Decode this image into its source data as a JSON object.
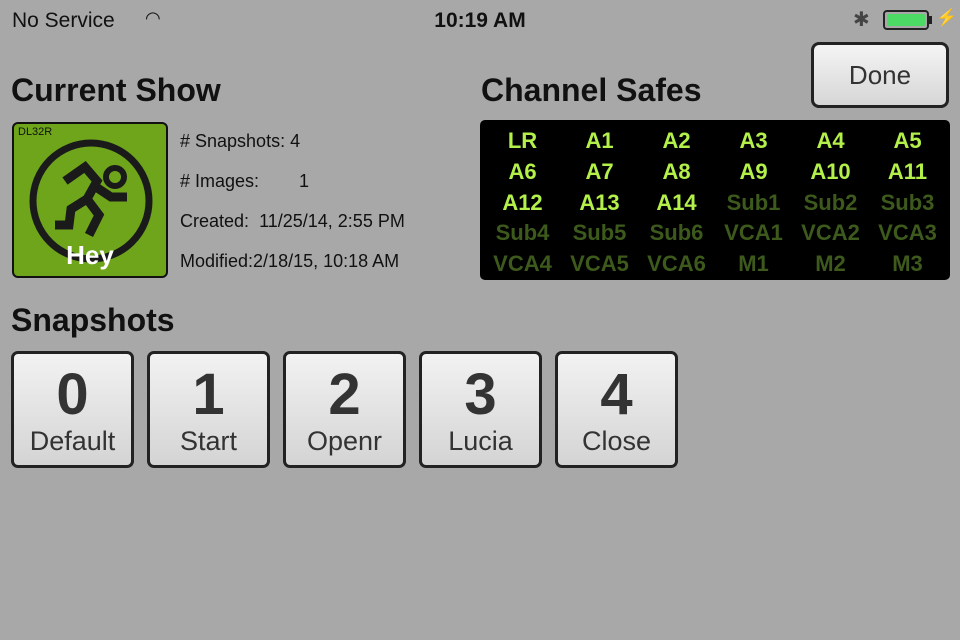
{
  "status": {
    "carrier": "No Service",
    "time": "10:19 AM",
    "battery_level": 1.0
  },
  "current_show": {
    "title": "Current Show",
    "model": "DL32R",
    "show_name": "Hey",
    "snapshots_label": "# Snapshots:",
    "snapshots_value": "4",
    "images_label": "# Images:",
    "images_value": "1",
    "created_label": "Created:",
    "created_value": "11/25/14, 2:55 PM",
    "modified_label": "Modified:",
    "modified_value": "2/18/15, 10:18 AM"
  },
  "done_label": "Done",
  "channel_safes": {
    "title": "Channel Safes",
    "channels": [
      {
        "label": "LR",
        "on": true
      },
      {
        "label": "A1",
        "on": true
      },
      {
        "label": "A2",
        "on": true
      },
      {
        "label": "A3",
        "on": true
      },
      {
        "label": "A4",
        "on": true
      },
      {
        "label": "A5",
        "on": true
      },
      {
        "label": "A6",
        "on": true
      },
      {
        "label": "A7",
        "on": true
      },
      {
        "label": "A8",
        "on": true
      },
      {
        "label": "A9",
        "on": true
      },
      {
        "label": "A10",
        "on": true
      },
      {
        "label": "A11",
        "on": true
      },
      {
        "label": "A12",
        "on": true
      },
      {
        "label": "A13",
        "on": true
      },
      {
        "label": "A14",
        "on": true
      },
      {
        "label": "Sub1",
        "on": false
      },
      {
        "label": "Sub2",
        "on": false
      },
      {
        "label": "Sub3",
        "on": false
      },
      {
        "label": "Sub4",
        "on": false
      },
      {
        "label": "Sub5",
        "on": false
      },
      {
        "label": "Sub6",
        "on": false
      },
      {
        "label": "VCA1",
        "on": false
      },
      {
        "label": "VCA2",
        "on": false
      },
      {
        "label": "VCA3",
        "on": false
      },
      {
        "label": "VCA4",
        "on": false
      },
      {
        "label": "VCA5",
        "on": false
      },
      {
        "label": "VCA6",
        "on": false
      },
      {
        "label": "M1",
        "on": false
      },
      {
        "label": "M2",
        "on": false
      },
      {
        "label": "M3",
        "on": false
      }
    ]
  },
  "snapshots": {
    "title": "Snapshots",
    "items": [
      {
        "number": "0",
        "name": "Default"
      },
      {
        "number": "1",
        "name": "Start"
      },
      {
        "number": "2",
        "name": "Openr"
      },
      {
        "number": "3",
        "name": "Lucia"
      },
      {
        "number": "4",
        "name": "Close"
      }
    ]
  }
}
